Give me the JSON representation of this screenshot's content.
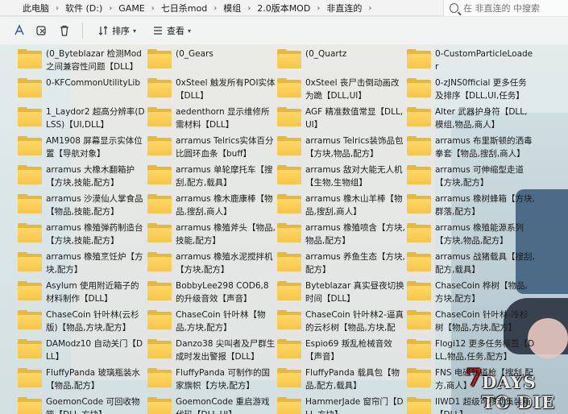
{
  "address": {
    "crumbs": [
      "此电脑",
      "软件 (D:)",
      "GAME",
      "七日杀mod",
      "模组",
      "2.0版本MOD",
      "非直连的"
    ]
  },
  "search": {
    "placeholder": "在 非直连的 中搜索"
  },
  "toolbar": {
    "sort_label": "排序",
    "view_label": "查看",
    "icons": [
      "ai-share-icon",
      "copy-link-icon",
      "delete-icon"
    ]
  },
  "files": [
    "(0_Byteblazar 检测Mod之间兼容性问题【DLL】",
    "(0_Gears",
    "(0_Quartz",
    "0-CustomParticleLoader",
    "0-KFCommonUtilityLib",
    "0xSteel 触发所有POI实体【DLL】",
    "0xSteel 丧尸击倒动画改为跪【DLL,UI】",
    "0-zJNS0fficial 更多任务及排序【DLL,UI,任务】",
    "1_Laydor2 超高分辨率(DLSS)【UI,DLL】",
    "aedenthorn 显示维修所需材料【DLL】",
    "AGF 精准数值常显【DLL,UI】",
    "Alter 武器护身符【DLL,模组,物品,商人】",
    "AM1908 屏幕显示实体位置【导航对象】",
    "arramus Telrics实体百分比圆环血条【buff】",
    "arramus Telrics装饰品包【方块,物品,配方】",
    "arramus 布里斯顿的洒毒拳套【物品,搜刮,商人】",
    "arramus 大橡木翻箱护【方块,技能,配方】",
    "arramus 单轮摩托车【搜刮,配方,载具】",
    "arramus 敌对大能无人机【生物,生物组】",
    "arramus 可伸缩型走道【方块,配方】",
    "arramus 沙漠仙人掌食品【物品,技能,配方】",
    "arramus 橡木鹿康棒【物品,搜刮,商人】",
    "arramus 橡木山羊棒【物品,搜刮,商人】",
    "arramus 橡树蜂箱【方块,群落,配方】",
    "arramus 橡殖弹药制造台【方块,技能,配方】",
    "arramus 橡殖斧头【物品,技能,配方】",
    "arramus 橡殖喷含【方块,物品,配方】",
    "arramus 橡殖能源系列【方块,物品,配方】",
    "arramus 橡殖烹饪炉【方块,配方】",
    "arramus 橡殖水泥搅拌机【方块,配方】",
    "arramus 养鱼生态【方块,配方】",
    "arramus 战猪载具【搜刮,配方,载具】",
    "Asylum 使用附近箱子的材料制作【DLL】",
    "BobbyLee298 COD6,8的升级音效【声音】",
    "Byteblazar 真实昼夜切换时间【DLL】",
    "ChaseCoin 桦树【物品,方块,配方】",
    "ChaseCoin 针叶林(云杉版)【物品,方块,配方】",
    "ChaseCoin 针叶林【物品,方块,配方】",
    "ChaseCoin 针叶林2-逼真的云杉树【物品,方块,配方】",
    "ChaseCoin 针叶林-冷杉树【物品,方块,配方】",
    "DAModz10 自动关门【DLL】",
    "Danzo38 尖叫者及尸群生成时发出警报【DLL】",
    "Espio69 叛乱枪械音效【声音】",
    "Flogi12 更多任务标签【DLL,物品,任务,配方】",
    "FluffyPanda 玻璃瓶装水【物品,配方】",
    "FluffyPanda 可制作的国家旗帜【方块,配方】",
    "FluffyPanda 载具包【物品,配方,载具】",
    "FNS 电磁轨道枪【搜刮,配方,商人】",
    "GoemonCode 可回收物箱【DLL,方块】",
    "GoemonCode 重启游戏代码【DLL,UI】",
    "HammerJade 窗帘门【DLL,方块】",
    "IIWD1 超级可移动集装箱【DLL】"
  ],
  "wallpaper": {
    "logo_text": "7 DAYS TO DIE"
  },
  "colors": {
    "folder_back": "#e8b83c",
    "folder_front": "#ffd868",
    "toolbar_bg": "#f3f3f3"
  }
}
